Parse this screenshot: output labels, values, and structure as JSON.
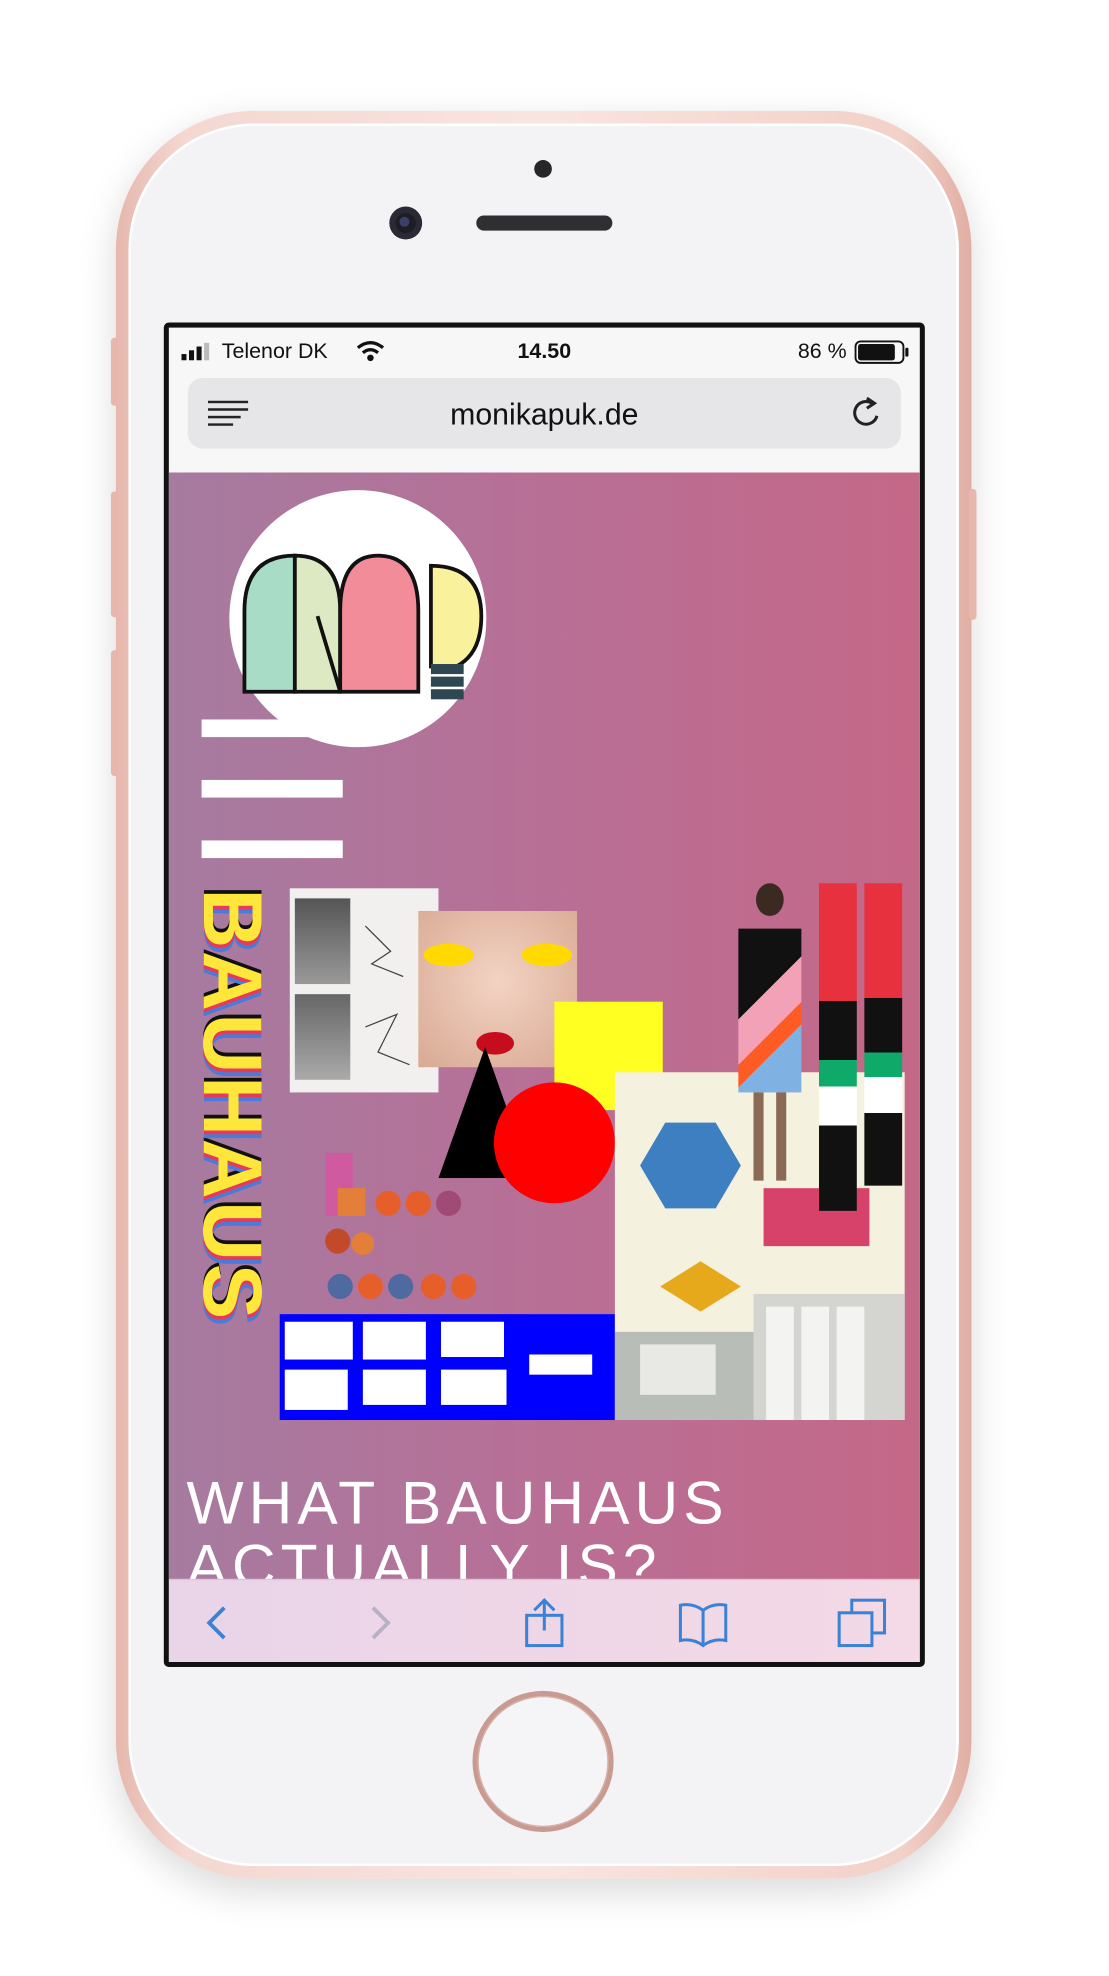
{
  "status_bar": {
    "carrier": "Telenor DK",
    "time": "14.50",
    "battery_percent": "86 %",
    "battery_level": 0.86
  },
  "browser": {
    "url": "monikapuk.de"
  },
  "page": {
    "vertical_word": "BAUHAUS",
    "headline": "WHAT BAUHAUS\nACTUALLY IS?"
  },
  "colors": {
    "page_bg_left": "#a67ba0",
    "page_bg_right": "#c46888",
    "toolbar_tint": "#3b82d6",
    "phone_frame": "#f1cfc6",
    "accent_yellow": "#ffff22",
    "accent_red": "#ff0000",
    "accent_blue": "#0000ff"
  },
  "icons": {
    "menu": "reader-menu-icon",
    "reload": "reload-icon",
    "back": "back-chevron-icon",
    "forward": "forward-chevron-icon",
    "share": "share-icon",
    "bookmarks": "book-icon",
    "tabs": "tabs-icon"
  }
}
